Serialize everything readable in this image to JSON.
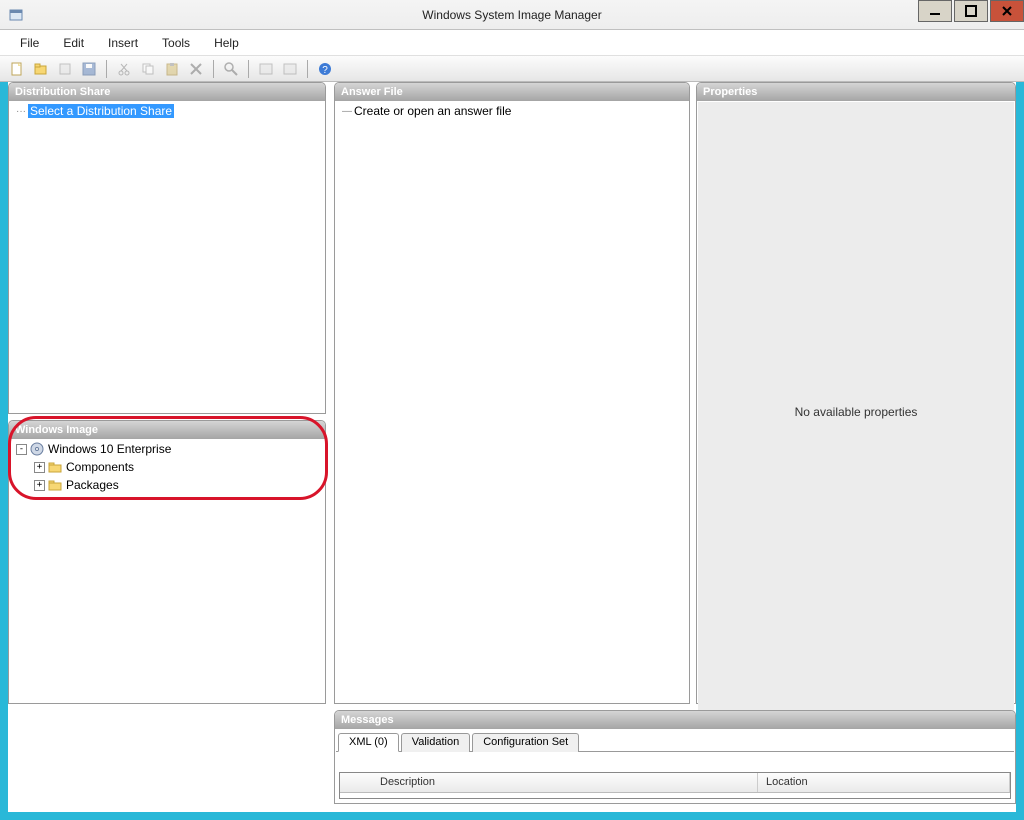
{
  "window": {
    "title": "Windows System Image Manager"
  },
  "menu": {
    "file": "File",
    "edit": "Edit",
    "insert": "Insert",
    "tools": "Tools",
    "help": "Help"
  },
  "panes": {
    "distribution_share": {
      "title": "Distribution Share",
      "placeholder": "Select a Distribution Share"
    },
    "windows_image": {
      "title": "Windows Image",
      "root": "Windows 10 Enterprise",
      "children": {
        "components": "Components",
        "packages": "Packages"
      }
    },
    "answer_file": {
      "title": "Answer File",
      "placeholder": "Create or open an answer file"
    },
    "properties": {
      "title": "Properties",
      "empty": "No available properties"
    },
    "messages": {
      "title": "Messages",
      "tabs": {
        "xml": "XML (0)",
        "validation": "Validation",
        "config": "Configuration Set"
      },
      "columns": {
        "description": "Description",
        "location": "Location"
      }
    }
  }
}
